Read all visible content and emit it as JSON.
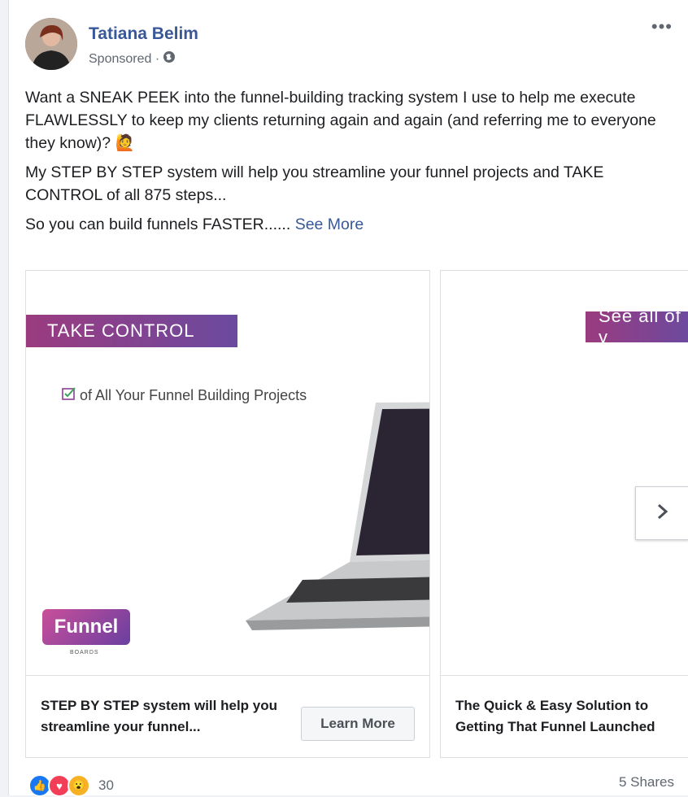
{
  "post": {
    "author": "Tatiana Belim",
    "sponsored": "Sponsored ·",
    "paragraph1": "Want a SNEAK PEEK into the funnel-building tracking system I use to help me execute FLAWLESSLY to keep my clients returning again and again (and referring me to everyone they know)?",
    "paragraph1_emoji": "🙋",
    "paragraph2": "My STEP BY STEP system will help you streamline your funnel projects and TAKE CONTROL of all 875 steps...",
    "paragraph3": "So you can build funnels FASTER......",
    "see_more": "See More"
  },
  "cards": [
    {
      "banner": "TAKE CONTROL",
      "subtitle": "of All Your Funnel Building Projects",
      "logo": "Funnel",
      "logo_sub": "BOARDS",
      "title": "STEP BY STEP system will help you streamline your funnel...",
      "button": "Learn More"
    },
    {
      "banner": "See all of y",
      "title": "The Quick & Easy Solution to Getting That Funnel Launched"
    }
  ],
  "reactions": {
    "count": "30",
    "shares": "5 Shares"
  },
  "colors": {
    "link": "#385898",
    "like": "#1877f2",
    "love": "#f33e58",
    "wow": "#f7b125"
  }
}
